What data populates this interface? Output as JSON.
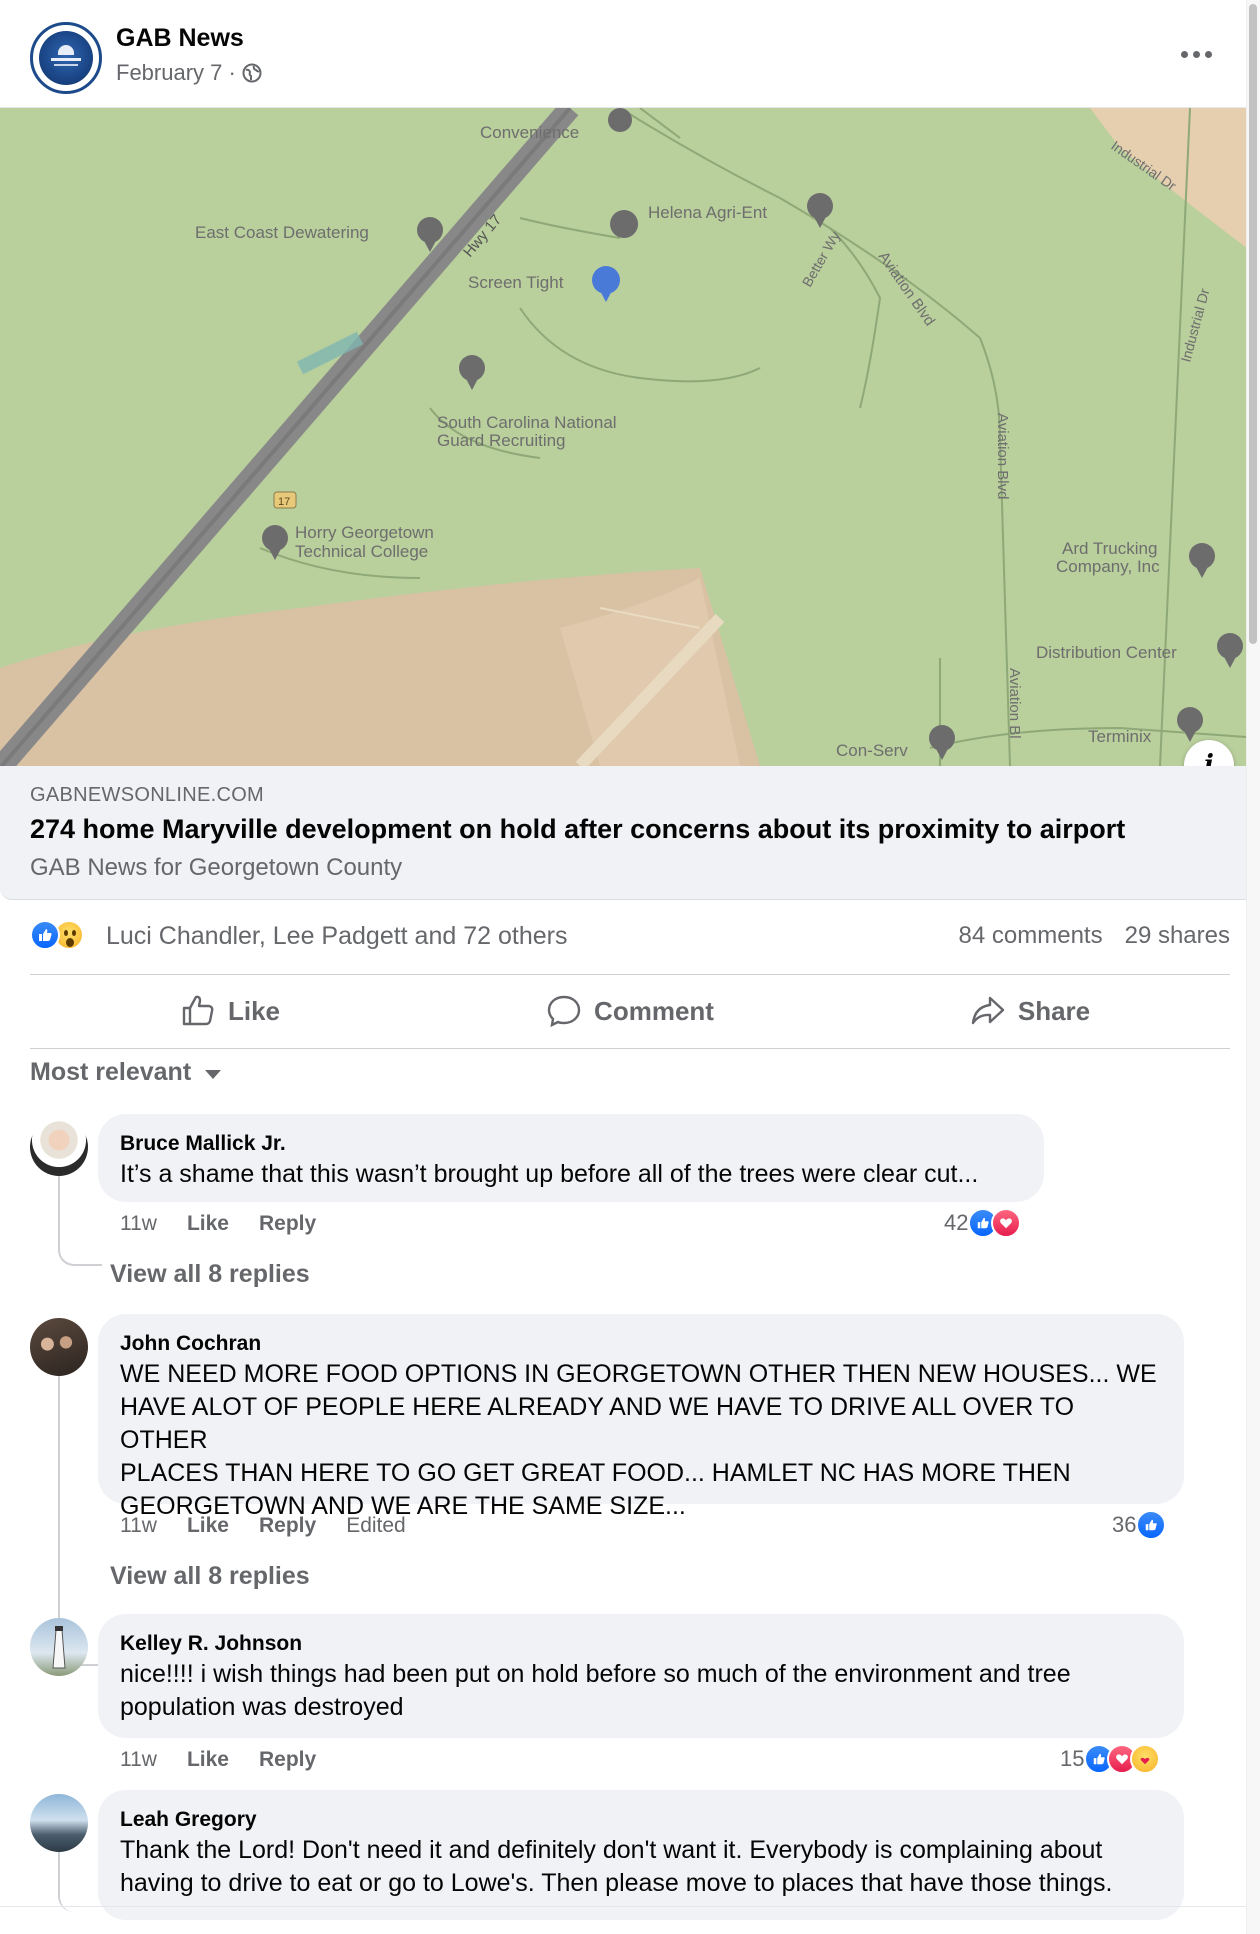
{
  "post": {
    "page_name": "GAB News",
    "date": "February 7 ·",
    "privacy_icon": "globe-icon",
    "menu_icon": "more-options-icon"
  },
  "map": {
    "labels": {
      "convenience": "Convenience",
      "east_coast": "East Coast Dewatering",
      "helena": "Helena Agri-Ent",
      "screen_tight": "Screen Tight",
      "hwy": "Hwy 17",
      "better_wy": "Better Wy",
      "aviation_1": "Aviation Blvd",
      "aviation_2": "Aviation Blvd",
      "aviation_3": "Aviation Bl",
      "industrial_1": "Industrial Dr",
      "industrial_2": "Industrial Dr",
      "scng_1": "South Carolina National",
      "scng_2": "Guard Recruiting",
      "horry_1": "Horry Georgetown",
      "horry_2": "Technical College",
      "ard_1": "Ard Trucking",
      "ard_2": "Company, Inc",
      "dist": "Distribution Center",
      "conserv": "Con-Serv",
      "terminix": "Terminix",
      "shield": "17"
    }
  },
  "link": {
    "domain": "GABNEWSONLINE.COM",
    "title": "274 home Maryville development on hold after concerns about its proximity to airport",
    "subtitle": "GAB News for Georgetown County"
  },
  "stats": {
    "reactors": "Luci Chandler, Lee Padgett and 72 others",
    "comments": "84 comments",
    "shares": "29 shares"
  },
  "actions": {
    "like": "Like",
    "comment": "Comment",
    "share": "Share"
  },
  "sort_label": "Most relevant",
  "comments": [
    {
      "name": "Bruce Mallick Jr.",
      "text": "It’s a shame that this wasn’t brought up before all of the trees were clear cut...",
      "time": "11w",
      "like": "Like",
      "reply": "Reply",
      "edited": "",
      "reaction_count": "42",
      "replies": "View all 8 replies"
    },
    {
      "name": "John Cochran",
      "text": "WE NEED MORE FOOD OPTIONS IN GEORGETOWN OTHER THEN NEW HOUSES... WE\nHAVE ALOT OF PEOPLE HERE ALREADY AND WE HAVE TO DRIVE ALL OVER TO OTHER\nPLACES THAN HERE TO GO GET GREAT FOOD... HAMLET NC HAS MORE THEN\nGEORGETOWN AND WE ARE THE SAME SIZE...",
      "time": "11w",
      "like": "Like",
      "reply": "Reply",
      "edited": "Edited",
      "reaction_count": "36",
      "replies": "View all 8 replies"
    },
    {
      "name": "Kelley R. Johnson",
      "text": "nice!!!! i wish things had been put on hold before so much of the environment and tree\npopulation was destroyed",
      "time": "11w",
      "like": "Like",
      "reply": "Reply",
      "edited": "",
      "reaction_count": "15",
      "replies": ""
    },
    {
      "name": "Leah Gregory",
      "text": "Thank the Lord! Don't need it and definitely don't want it. Everybody is complaining about\nhaving to drive to eat or go to Lowe's. Then please move to places that have those things.",
      "time": "",
      "like": "",
      "reply": "",
      "edited": "",
      "reaction_count": "",
      "replies": ""
    }
  ],
  "colors": {
    "accent_blue": "#0866ff",
    "text_secondary": "#65676b",
    "bubble_bg": "#f0f2f5",
    "map_green": "#b9cf9c"
  }
}
